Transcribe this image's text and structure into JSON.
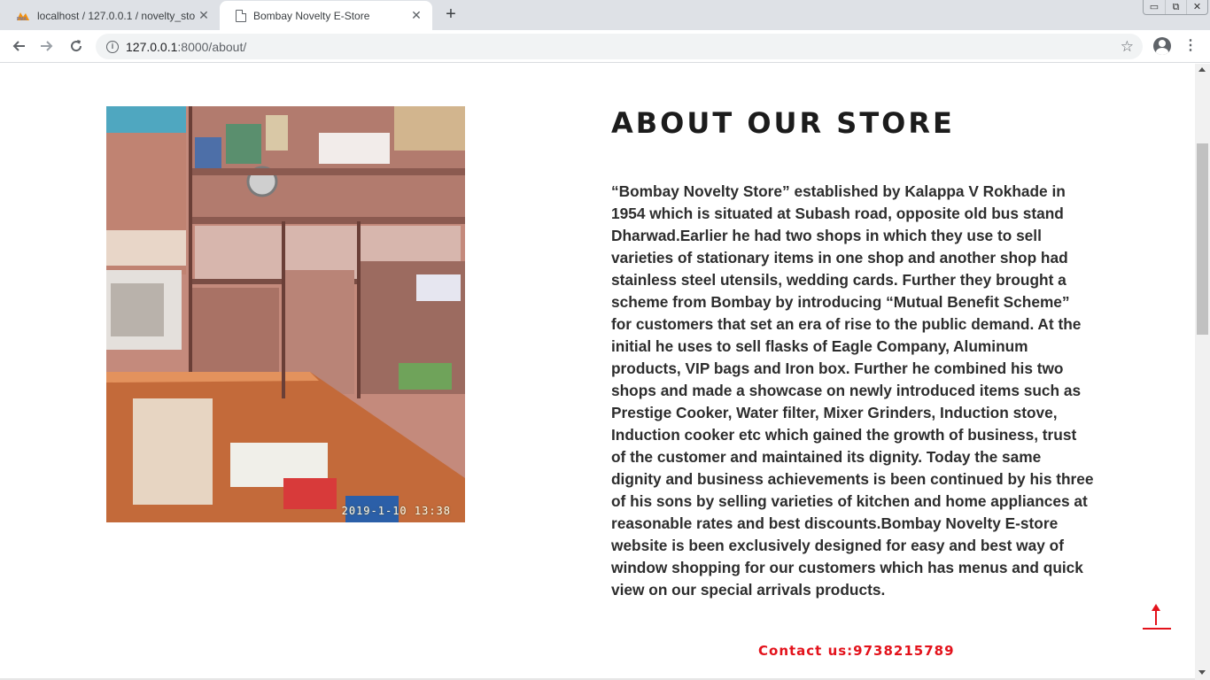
{
  "browser": {
    "tabs": [
      {
        "title": "localhost / 127.0.0.1 / novelty_sto",
        "active": false,
        "icon": "phpmyadmin-icon"
      },
      {
        "title": "Bombay Novelty E-Store",
        "active": true,
        "icon": "document-icon"
      }
    ],
    "new_tab_label": "+",
    "url_host": "127.0.0.1",
    "url_path": ":8000/about/",
    "window_controls": {
      "minimize": "▭",
      "restore": "⧉",
      "close": "✕"
    }
  },
  "page": {
    "heading": "ABOUT OUR STORE",
    "about_text": "“Bombay Novelty Store” established by Kalappa V Rokhade in 1954 which is situated at Subash road, opposite old bus stand Dharwad.Earlier he had two shops in which they use to sell varieties of stationary items in one shop and another shop had stainless steel utensils, wedding cards. Further they brought a scheme from Bombay by introducing “Mutual Benefit Scheme” for customers that set an era of rise to the public demand. At the initial he uses to sell flasks of Eagle Company, Aluminum products, VIP bags and Iron box. Further he combined his two shops and made a showcase on newly introduced items such as Prestige Cooker, Water filter, Mixer Grinders, Induction stove, Induction cooker etc which gained the growth of business, trust of the customer and maintained its dignity. Today the same dignity and business achievements is been continued by his three of his sons by selling varieties of kitchen and home appliances at reasonable rates and best discounts.Bombay Novelty E-store website is been exclusively designed for easy and best way of window shopping for our customers which has menus and quick view on our special arrivals products.",
    "photo_stamp": "2019-1-10 13:38",
    "contact": "Contact us:9738215789",
    "accent_color": "#e3121b"
  }
}
